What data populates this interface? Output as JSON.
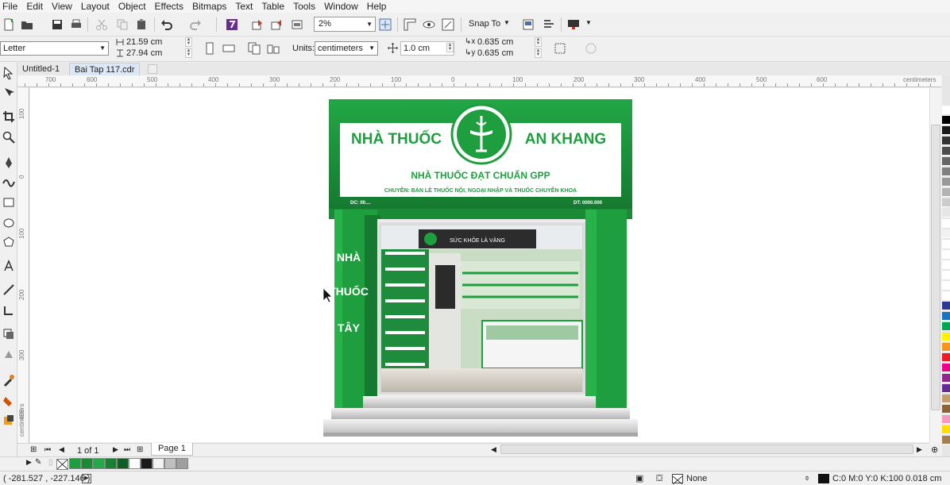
{
  "menu": [
    "File",
    "Edit",
    "View",
    "Layout",
    "Object",
    "Effects",
    "Bitmaps",
    "Text",
    "Table",
    "Tools",
    "Window",
    "Help"
  ],
  "toolbar": {
    "zoom": "2%",
    "snap_to": "Snap To"
  },
  "property_bar": {
    "page_size": "Letter",
    "width": "21.59 cm",
    "height": "27.94 cm",
    "units_label": "Units:",
    "units": "centimeters",
    "nudge": "1.0 cm",
    "dup_x": "0.635 cm",
    "dup_y": "0.635 cm"
  },
  "doc_tabs": [
    {
      "label": "Untitled-1",
      "active": false
    },
    {
      "label": "Bai Tap 117.cdr",
      "active": true
    }
  ],
  "ruler": {
    "h_labels": [
      "700",
      "600",
      "500",
      "400",
      "300",
      "200",
      "100",
      "0",
      "100",
      "200",
      "300",
      "400",
      "500",
      "600"
    ],
    "h_unit": "centimeters",
    "v_labels": [
      "100",
      "0",
      "100",
      "200",
      "300",
      "400"
    ],
    "v_unit": "centimeters"
  },
  "artwork": {
    "store_name_left": "NHÀ THUỐC",
    "store_name_right": "AN KHANG",
    "headline": "NHÀ THUỐC ĐẠT CHUẨN GPP",
    "subline": "CHUYÊN: BÁN LẺ THUỐC NỘI, NGOẠI NHẬP VÀ THUỐC CHUYÊN KHOA",
    "address": "DC: 00....",
    "phone": "DT: 0000.000",
    "pillar_text": [
      "NHÀ",
      "THUỐC",
      "TÂY"
    ],
    "interior_sign": "SỨC KHỎE LÀ VÀNG"
  },
  "page_nav": {
    "count": "1 of 1",
    "page_tab": "Page 1"
  },
  "status": {
    "coords": "( -281.527 , -227.146 )",
    "fill": "None",
    "outline": "C:0 M:0 Y:0 K:100  0.018 cm"
  },
  "colors": {
    "brand_green": "#1f9e3f",
    "dark_green": "#157a30",
    "light_green": "#27b34a"
  },
  "palette": [
    "#ffffff",
    "#000000",
    "#1a1a1a",
    "#333333",
    "#4d4d4d",
    "#666666",
    "#808080",
    "#999999",
    "#b3b3b3",
    "#cccccc",
    "#e6e6e6",
    "#ffffff",
    "#f2f2f2",
    "#ffffff",
    "#ffffff",
    "#ffffff",
    "#ffffff",
    "#ffffff",
    "#ffffff",
    "#2b3990",
    "#1c75bc",
    "#00a651",
    "#fff200",
    "#f7941d",
    "#ed1c24",
    "#ec008c",
    "#92278f",
    "#662d91",
    "#c69c6d",
    "#8c6239",
    "#f49ac1",
    "#ffdd00",
    "#a67c52"
  ],
  "doc_palette": [
    "#1f9e3f",
    "#1b8a37",
    "#26a84a",
    "#178033",
    "#0f5e24",
    "#ffffff",
    "#1a1a1a",
    "#f2f2f2",
    "#bfbfbf",
    "#9f9f9f"
  ]
}
